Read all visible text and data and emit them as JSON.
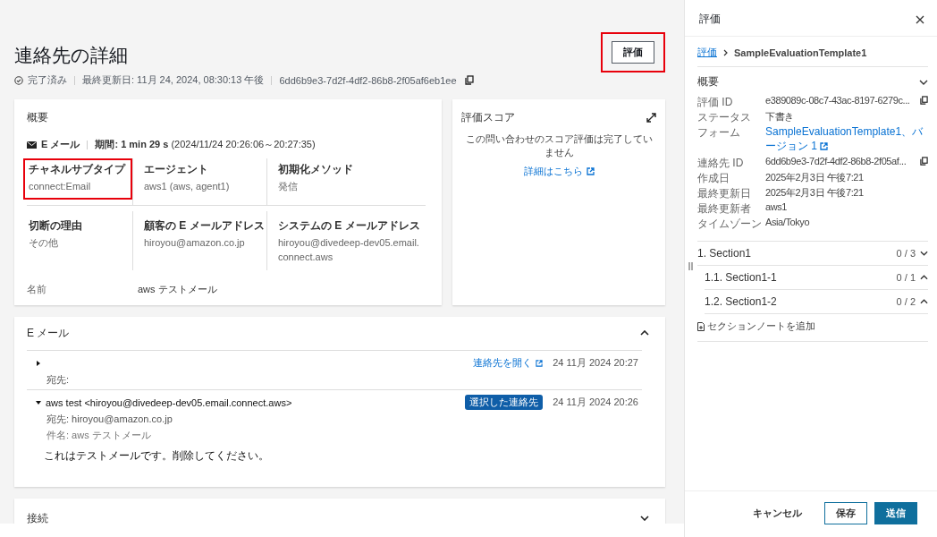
{
  "header": {
    "title": "連絡先の詳細",
    "status": "完了済み",
    "last_updated": "最終更新日: 11月 24, 2024, 08:30:13 午後",
    "contact_id": "6dd6b9e3-7d2f-4df2-86b8-2f05af6eb1ee",
    "evaluate_button": {
      "label": "評価",
      "highlighted": true
    }
  },
  "overview": {
    "title": "概要",
    "channel": "E メール",
    "duration": "**期間: 1 min 29 s** (2024/11/24 20:26:06～20:27:35)",
    "fields": [
      {
        "label": "チャネルサブタイプ",
        "value": "connect:Email",
        "highlighted": true
      },
      {
        "label": "エージェント",
        "value": "aws1 (aws, agent1)",
        "highlighted": false
      },
      {
        "label": "初期化メソッド",
        "value": "発信",
        "highlighted": false
      },
      {
        "label": "切断の理由",
        "value": "その他",
        "highlighted": false
      },
      {
        "label": "顧客の E メールアドレス",
        "value": "hiroyou@amazon.co.jp",
        "highlighted": false
      },
      {
        "label": "システムの E メールアドレス",
        "value": "hiroyou@divedeep-dev05.email.connect.aws",
        "highlighted": false
      }
    ],
    "name": {
      "label": "名前",
      "value": "aws テストメール"
    }
  },
  "score": {
    "title": "評価スコア",
    "message": "この問い合わせのスコア評価は完了していません",
    "link": "詳細はこちら"
  },
  "email": {
    "title": "E メール",
    "expanded": true,
    "messages": [
      {
        "expanded": false,
        "to": "宛先:",
        "link": "連絡先を開く",
        "date": "24 11月 2024 20:27"
      },
      {
        "expanded": true,
        "from": "aws test <hiroyou@divedeep-dev05.email.connect.aws>",
        "badge": "選択した連絡先",
        "date": "24 11月 2024 20:26",
        "to": "宛先: hiroyou@amazon.co.jp",
        "subject": "件名: aws テストメール",
        "body": "これはテストメールです。削除してください。"
      }
    ]
  },
  "connection": {
    "title": "接続",
    "expanded": false
  },
  "panel": {
    "title": "評価",
    "breadcrumb": [
      {
        "label": "評価",
        "link": true
      },
      {
        "label": "SampleEvaluationTemplate1",
        "link": false
      }
    ],
    "overview": {
      "title": "概要",
      "expanded": true,
      "rows": [
        {
          "label": "評価 ID",
          "value": "e389089c-08c7-43ac-8197-6279c...",
          "kind": "copy"
        },
        {
          "label": "ステータス",
          "value": "下書き",
          "kind": "text"
        },
        {
          "label": "フォーム",
          "value": "SampleEvaluationTemplate1、バージョン 1",
          "kind": "link"
        },
        {
          "label": "連絡先 ID",
          "value": "6dd6b9e3-7d2f-4df2-86b8-2f05af...",
          "kind": "copy"
        },
        {
          "label": "作成日",
          "value": "2025年2月3日 午後7:21",
          "kind": "text"
        },
        {
          "label": "最終更新日",
          "value": "2025年2月3日 午後7:21",
          "kind": "text"
        },
        {
          "label": "最終更新者",
          "value": "aws1",
          "kind": "text"
        },
        {
          "label": "タイムゾーン",
          "value": "Asia/Tokyo",
          "kind": "text"
        }
      ]
    },
    "sections": [
      {
        "title": "1. Section1",
        "score": "0 / 3",
        "expanded": true,
        "children": [
          {
            "title": "1.1. Section1-1",
            "score": "0 / 1",
            "expanded": false
          },
          {
            "title": "1.2. Section1-2",
            "score": "0 / 2",
            "expanded": false
          }
        ]
      }
    ],
    "add_note": "セクションノートを追加",
    "buttons": [
      {
        "label": "キャンセル",
        "kind": "link"
      },
      {
        "label": "保存",
        "kind": "secondary"
      },
      {
        "label": "送信",
        "kind": "primary"
      }
    ]
  }
}
